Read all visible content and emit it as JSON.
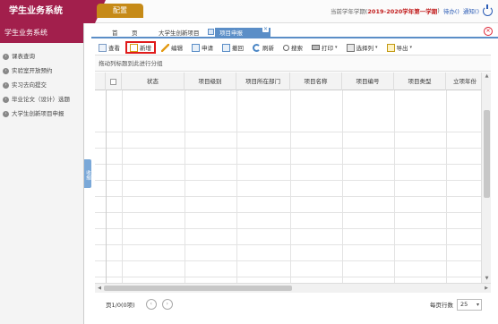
{
  "header": {
    "brand": "学生业务系统",
    "config_tab": "配置",
    "semester_prefix": "当前学年学期(",
    "semester": "2019-2020学年第一学期",
    "semester_suffix": ")",
    "pending": "待办()",
    "notice": "通知()"
  },
  "sidebar": {
    "title": "学生业务系统",
    "items": [
      {
        "label": "课表查询"
      },
      {
        "label": "实验室开放预约"
      },
      {
        "label": "实习去向提交"
      },
      {
        "label": "毕业论文（设计）选题"
      },
      {
        "label": "大学生创新项目申报"
      }
    ],
    "collapse_label": "收缩"
  },
  "tabs": {
    "home": "首",
    "page": "页",
    "project": "大学生创新项目",
    "active": "项目申报"
  },
  "toolbar": {
    "view": "查看",
    "new": "新增",
    "edit": "编辑",
    "apply": "申请",
    "undo": "撤回",
    "refresh": "刷新",
    "search": "搜索",
    "print": "打印",
    "select_cols": "选择列",
    "export": "导出"
  },
  "group_hint": "拖动列标题到此进行分组",
  "grid": {
    "columns": [
      "状态",
      "项目级别",
      "项目所在部门",
      "项目名称",
      "项目编号",
      "项目类型",
      "立项年份"
    ],
    "rows": []
  },
  "pager": {
    "info": "页1/0(0项)",
    "page_size_label": "每页行数",
    "page_size": "25"
  }
}
